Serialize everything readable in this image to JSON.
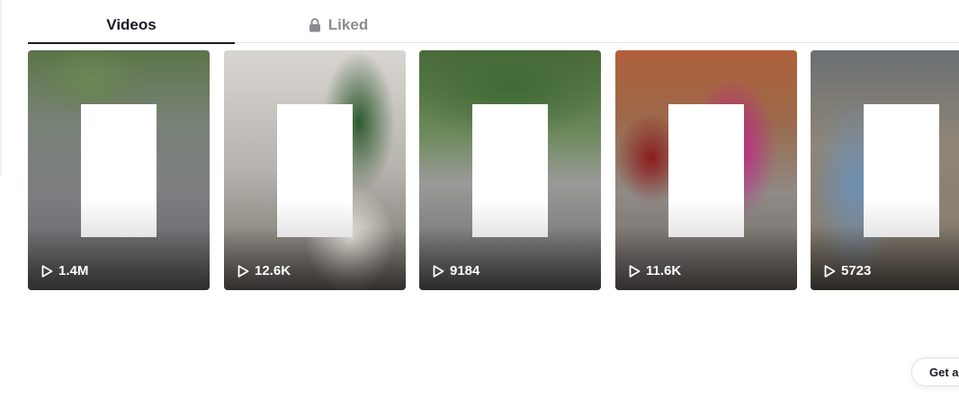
{
  "tabs": {
    "videos_label": "Videos",
    "liked_label": "Liked",
    "liked_icon": "lock-icon",
    "active": "Videos"
  },
  "videos": [
    {
      "views": "1.4M",
      "icon": "play-icon"
    },
    {
      "views": "12.6K",
      "icon": "play-icon"
    },
    {
      "views": "9184",
      "icon": "play-icon"
    },
    {
      "views": "11.6K",
      "icon": "play-icon"
    },
    {
      "views": "5723",
      "icon": "play-icon"
    }
  ],
  "footer": {
    "get_app_label": "Get a"
  },
  "colors": {
    "text_primary": "#161823",
    "text_secondary": "#8a8b91",
    "divider": "#e3e3e4"
  }
}
